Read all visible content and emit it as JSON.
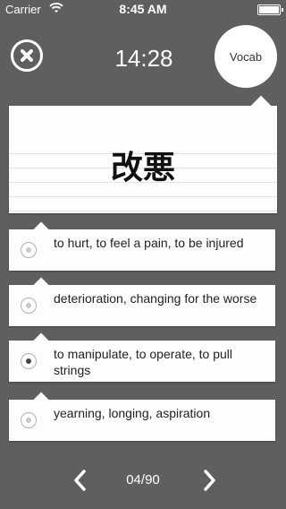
{
  "status_bar": {
    "carrier": "Carrier",
    "time": "8:45 AM",
    "wifi_icon": "wifi-icon",
    "battery_icon": "battery-icon"
  },
  "header": {
    "close_icon": "close-icon",
    "timer": "14:28",
    "vocab_label": "Vocab"
  },
  "card": {
    "word": "改悪"
  },
  "options": [
    {
      "text": "to hurt, to feel a pain, to be injured",
      "selected": false
    },
    {
      "text": "deterioration, changing for the worse",
      "selected": false
    },
    {
      "text": "to manipulate, to operate, to pull strings",
      "selected": true
    },
    {
      "text": "yearning, longing, aspiration",
      "selected": false
    }
  ],
  "footer": {
    "page_indicator": "04/90",
    "prev_icon": "chevron-left-icon",
    "next_icon": "chevron-right-icon"
  },
  "colors": {
    "background": "#5f5f5f",
    "card": "#fdfdfd",
    "text": "#222222",
    "accent": "#ffffff"
  }
}
